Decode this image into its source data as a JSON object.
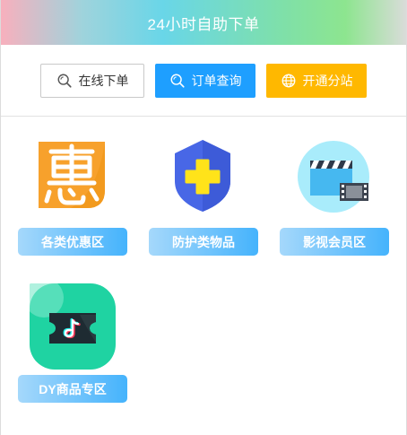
{
  "header": {
    "title": "24小时自助下单"
  },
  "toolbar": {
    "order_online": {
      "label": "在线下单",
      "icon": "search-icon"
    },
    "order_query": {
      "label": "订单查询",
      "icon": "search-icon"
    },
    "open_substation": {
      "label": "开通分站",
      "icon": "globe-icon"
    }
  },
  "categories": [
    {
      "label": "各类优惠区",
      "icon": "discount-hui-icon"
    },
    {
      "label": "防护类物品",
      "icon": "shield-cross-icon"
    },
    {
      "label": "影视会员区",
      "icon": "clapperboard-film-icon"
    },
    {
      "label": "DY商品专区",
      "icon": "tiktok-ticket-icon"
    }
  ],
  "colors": {
    "blue_button": "#1e9fff",
    "orange_button": "#ffb800",
    "label_gradient_start": "#a5d8fb",
    "label_gradient_end": "#45b3fc"
  }
}
